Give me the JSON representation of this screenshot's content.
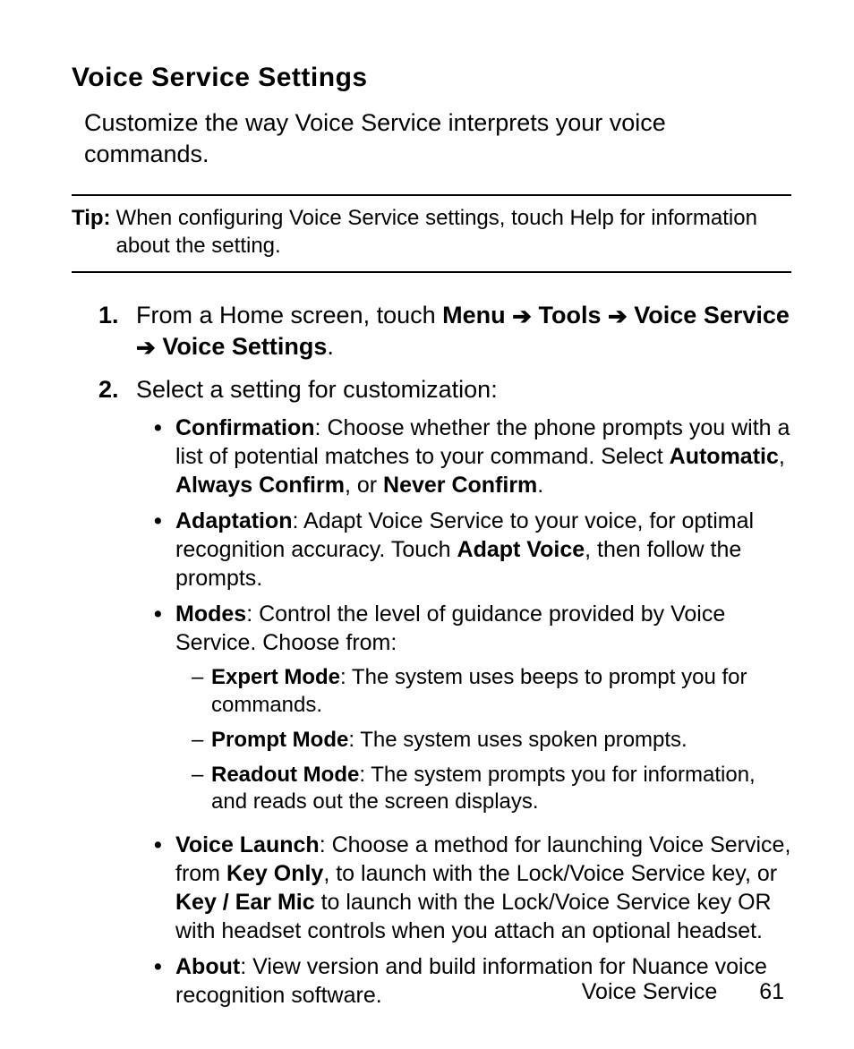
{
  "title": "Voice Service Settings",
  "intro": "Customize the way Voice Service interprets your voice commands.",
  "tip": {
    "label": "Tip:",
    "text": "When configuring Voice Service settings, touch Help for information about the setting."
  },
  "steps": {
    "s1": {
      "pre": "From a Home screen, touch ",
      "menu": "Menu",
      "tools": "Tools",
      "voice_service": "Voice Service",
      "voice_settings": "Voice Settings",
      "period": "."
    },
    "s2": {
      "text": "Select a setting for customization:"
    }
  },
  "bullets": {
    "confirmation": {
      "title": "Confirmation",
      "text_a": ": Choose whether the phone prompts you with a list of potential matches to your command. Select ",
      "opt1": "Automatic",
      "sep1": ", ",
      "opt2": "Always Confirm",
      "sep2": ", or ",
      "opt3": "Never Confirm",
      "period": "."
    },
    "adaptation": {
      "title": "Adaptation",
      "text_a": ": Adapt Voice Service to your voice, for optimal recognition accuracy. Touch ",
      "opt1": "Adapt Voice",
      "text_b": ", then follow the prompts."
    },
    "modes": {
      "title": "Modes",
      "text_a": ": Control the level of guidance provided by Voice Service. Choose from:",
      "dash1": {
        "title": "Expert Mode",
        "text": ": The system uses beeps to prompt you for commands."
      },
      "dash2": {
        "title": "Prompt Mode",
        "text": ": The system uses spoken prompts."
      },
      "dash3": {
        "title": "Readout Mode",
        "text": ": The system prompts you for information, and reads out the screen displays."
      }
    },
    "voice_launch": {
      "title": "Voice Launch",
      "text_a": ": Choose a method for launching Voice Service, from ",
      "opt1": "Key Only",
      "text_b": ", to launch with the Lock/Voice Service key, or ",
      "opt2": "Key / Ear Mic",
      "text_c": " to launch with the Lock/Voice Service key OR with headset controls when you attach an optional headset."
    },
    "about": {
      "title": "About",
      "text_a": ": View version and build information for Nuance voice recognition software."
    }
  },
  "footer": {
    "section": "Voice Service",
    "page": "61"
  },
  "glyphs": {
    "arrow": "➔"
  }
}
